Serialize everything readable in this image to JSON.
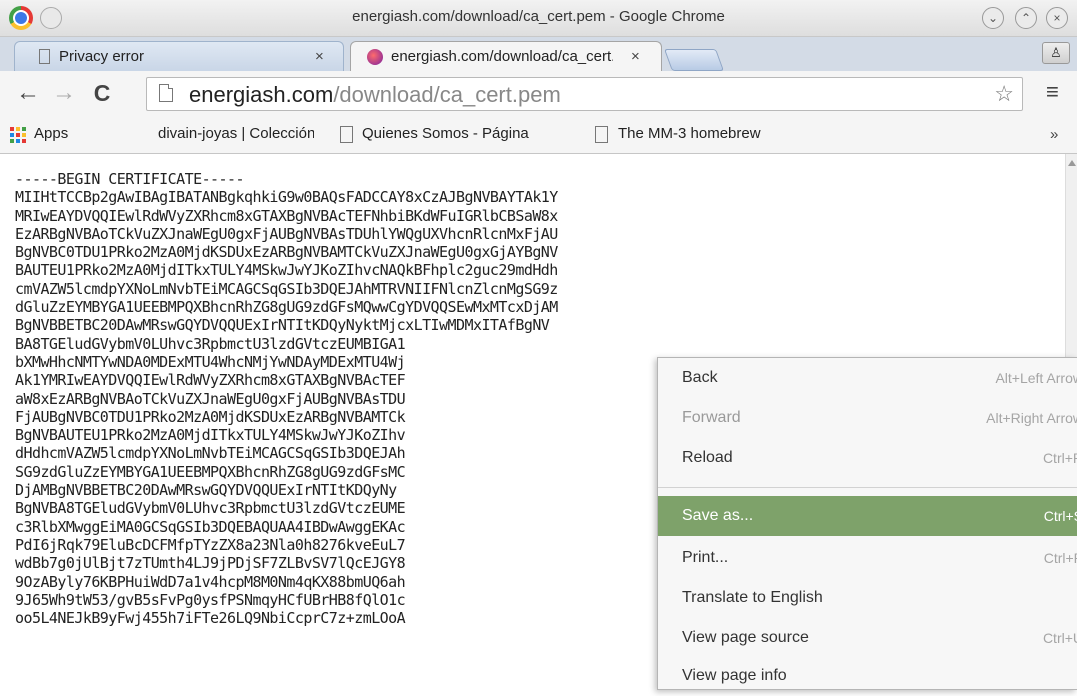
{
  "window": {
    "title": "energiash.com/download/ca_cert.pem - Google Chrome"
  },
  "tabs": [
    {
      "label": "Privacy error",
      "close": "×"
    },
    {
      "label": "energiash.com/download/ca_cert.pem",
      "close": "×"
    }
  ],
  "toolbar": {
    "back": "←",
    "forward": "→",
    "reload": "C",
    "url_host": "energiash.com",
    "url_path": "/download/ca_cert.pem",
    "star": "☆",
    "menu": "≡"
  },
  "bookmarks": {
    "apps_label": "Apps",
    "items": [
      "divain-joyas | Colección",
      "Quienes Somos - Página",
      "The MM-3 homebrew"
    ],
    "more": "»"
  },
  "certificate_text": "-----BEGIN CERTIFICATE-----\nMIIHtTCCBp2gAwIBAgIBATANBgkqhkiG9w0BAQsFADCCAY8xCzAJBgNVBAYTAk1Y\nMRIwEAYDVQQIEwlRdWVyZXRhcm8xGTAXBgNVBAcTEFNhbiBKdWFuIGRlbCBSaW8x\nEzARBgNVBAoTCkVuZXJnaWEgU0gxFjAUBgNVBAsTDUhlYWQgUXVhcnRlcnMxFjAU\nBgNVBC0TDU1PRko2MzA0MjdKSDUxEzARBgNVBAMTCkVuZXJnaWEgU0gxGjAYBgNV\nBAUTEU1PRko2MzA0MjdITkxTULY4MSkwJwYJKoZIhvcNAQkBFhplc2guc29mdHdh\ncmVAZW5lcmdpYXNoLmNvbTEiMCAGCSqGSIb3DQEJAhMTRVNIIFNlcnZlcnMgSG9z\ndGluZzEYMBYGA1UEEBMPQXBhcnRhZG8gUG9zdGFsMQwwCgYDVQQSEwMxMTcxDjAM\nBgNVBBETBC20DAwMRswGQYDVQQUExIrNTItKDQyNyktMjcxLTIwMDMxITAfBgNV\nBA8TGEludGVybmV0LUhvc3RpbmctU3lzdGVtczEUMBIGA1\nbXMwHhcNMTYwNDA0MDExMTU4WhcNMjYwNDAyMDExMTU4Wj\nAk1YMRIwEAYDVQQIEwlRdWVyZXRhcm8xGTAXBgNVBAcTEF\naW8xEzARBgNVBAoTCkVuZXJnaWEgU0gxFjAUBgNVBAsTDU\nFjAUBgNVBC0TDU1PRko2MzA0MjdKSDUxEzARBgNVBAMTCk\nBgNVBAUTEU1PRko2MzA0MjdITkxTULY4MSkwJwYJKoZIhv\ndHdhcmVAZW5lcmdpYXNoLmNvbTEiMCAGCSqGSIb3DQEJAh\nSG9zdGluZzEYMBYGA1UEEBMPQXBhcnRhZG8gUG9zdGFsMC\nDjAMBgNVBBETBC20DAwMRswGQYDVQQUExIrNTItKDQyNy\nBgNVBA8TGEludGVybmV0LUhvc3RpbmctU3lzdGVtczEUME\nc3RlbXMwggEiMA0GCSqGSIb3DQEBAQUAA4IBDwAwggEKAc\nPdI6jRqk79EluBcDCFMfpTYzZX8a23Nla0h8276kveEuL7\nwdBb7g0jUlBjt7zTUmth4LJ9jPDjSF7ZLBvSV7lQcEJGY8\n9OzAByly76KBPHuiWdD7a1v4hcpM8M0Nm4qKX88bmUQ6ah\n9J65Wh9tW53/gvB5sFvPg0ysfPSNmqyHCfUBrHB8fQlO1c\noo5L4NEJkB9yFwj455h7iFTe26LQ9NbiCcprC7z+zmLOoA",
  "context_menu": {
    "items": [
      {
        "label": "Back",
        "shortcut": "Alt+Left Arrow"
      },
      {
        "label": "Forward",
        "shortcut": "Alt+Right Arrow"
      },
      {
        "label": "Reload",
        "shortcut": "Ctrl+R"
      },
      {
        "label": "Save as...",
        "shortcut": "Ctrl+S"
      },
      {
        "label": "Print...",
        "shortcut": "Ctrl+P"
      },
      {
        "label": "Translate to English",
        "shortcut": ""
      },
      {
        "label": "View page source",
        "shortcut": "Ctrl+U"
      },
      {
        "label": "View page info",
        "shortcut": ""
      }
    ]
  },
  "colors": {
    "menu_highlight": "#7ea26a",
    "tab_strip": "#d3dbe6",
    "toolbar": "#f5f5f5"
  }
}
